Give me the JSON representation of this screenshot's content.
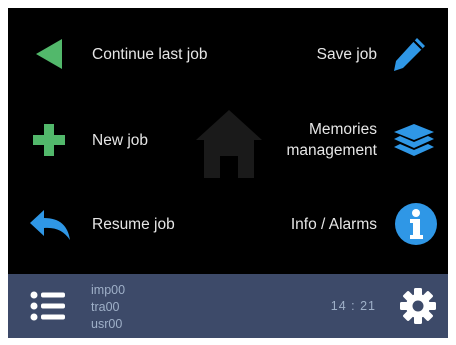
{
  "menu": {
    "continue_last_job": "Continue last job",
    "save_job": "Save job",
    "new_job": "New job",
    "memories_line1": "Memories",
    "memories_line2": "management",
    "resume_job": "Resume job",
    "info_alarms": "Info / Alarms"
  },
  "status_bar": {
    "line1": "imp00",
    "line2": "tra00",
    "line3": "usr00",
    "clock": "14 : 21"
  },
  "icons": {
    "continue": "play-left-icon",
    "save": "pencil-icon",
    "new": "plus-icon",
    "memories": "layers-icon",
    "resume": "reply-arrow-icon",
    "info": "info-icon",
    "home": "home-icon",
    "list": "list-icon",
    "settings": "gear-icon"
  },
  "colors": {
    "green": "#52b86b",
    "blue": "#2f97e6",
    "bar_bg": "#3d4a69",
    "background": "#000000"
  }
}
